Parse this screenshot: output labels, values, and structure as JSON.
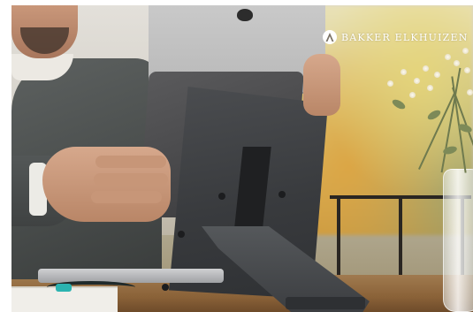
{
  "brand": {
    "name": "Bakker Elkhuizen",
    "display": "BAKKER ELKHUIZEN",
    "text_color": "#ffffff"
  },
  "scene": {
    "subject": "person placing laptop on a folding laptop stand",
    "stand_color": "#3f4144",
    "desk_color": "#8a6238"
  }
}
